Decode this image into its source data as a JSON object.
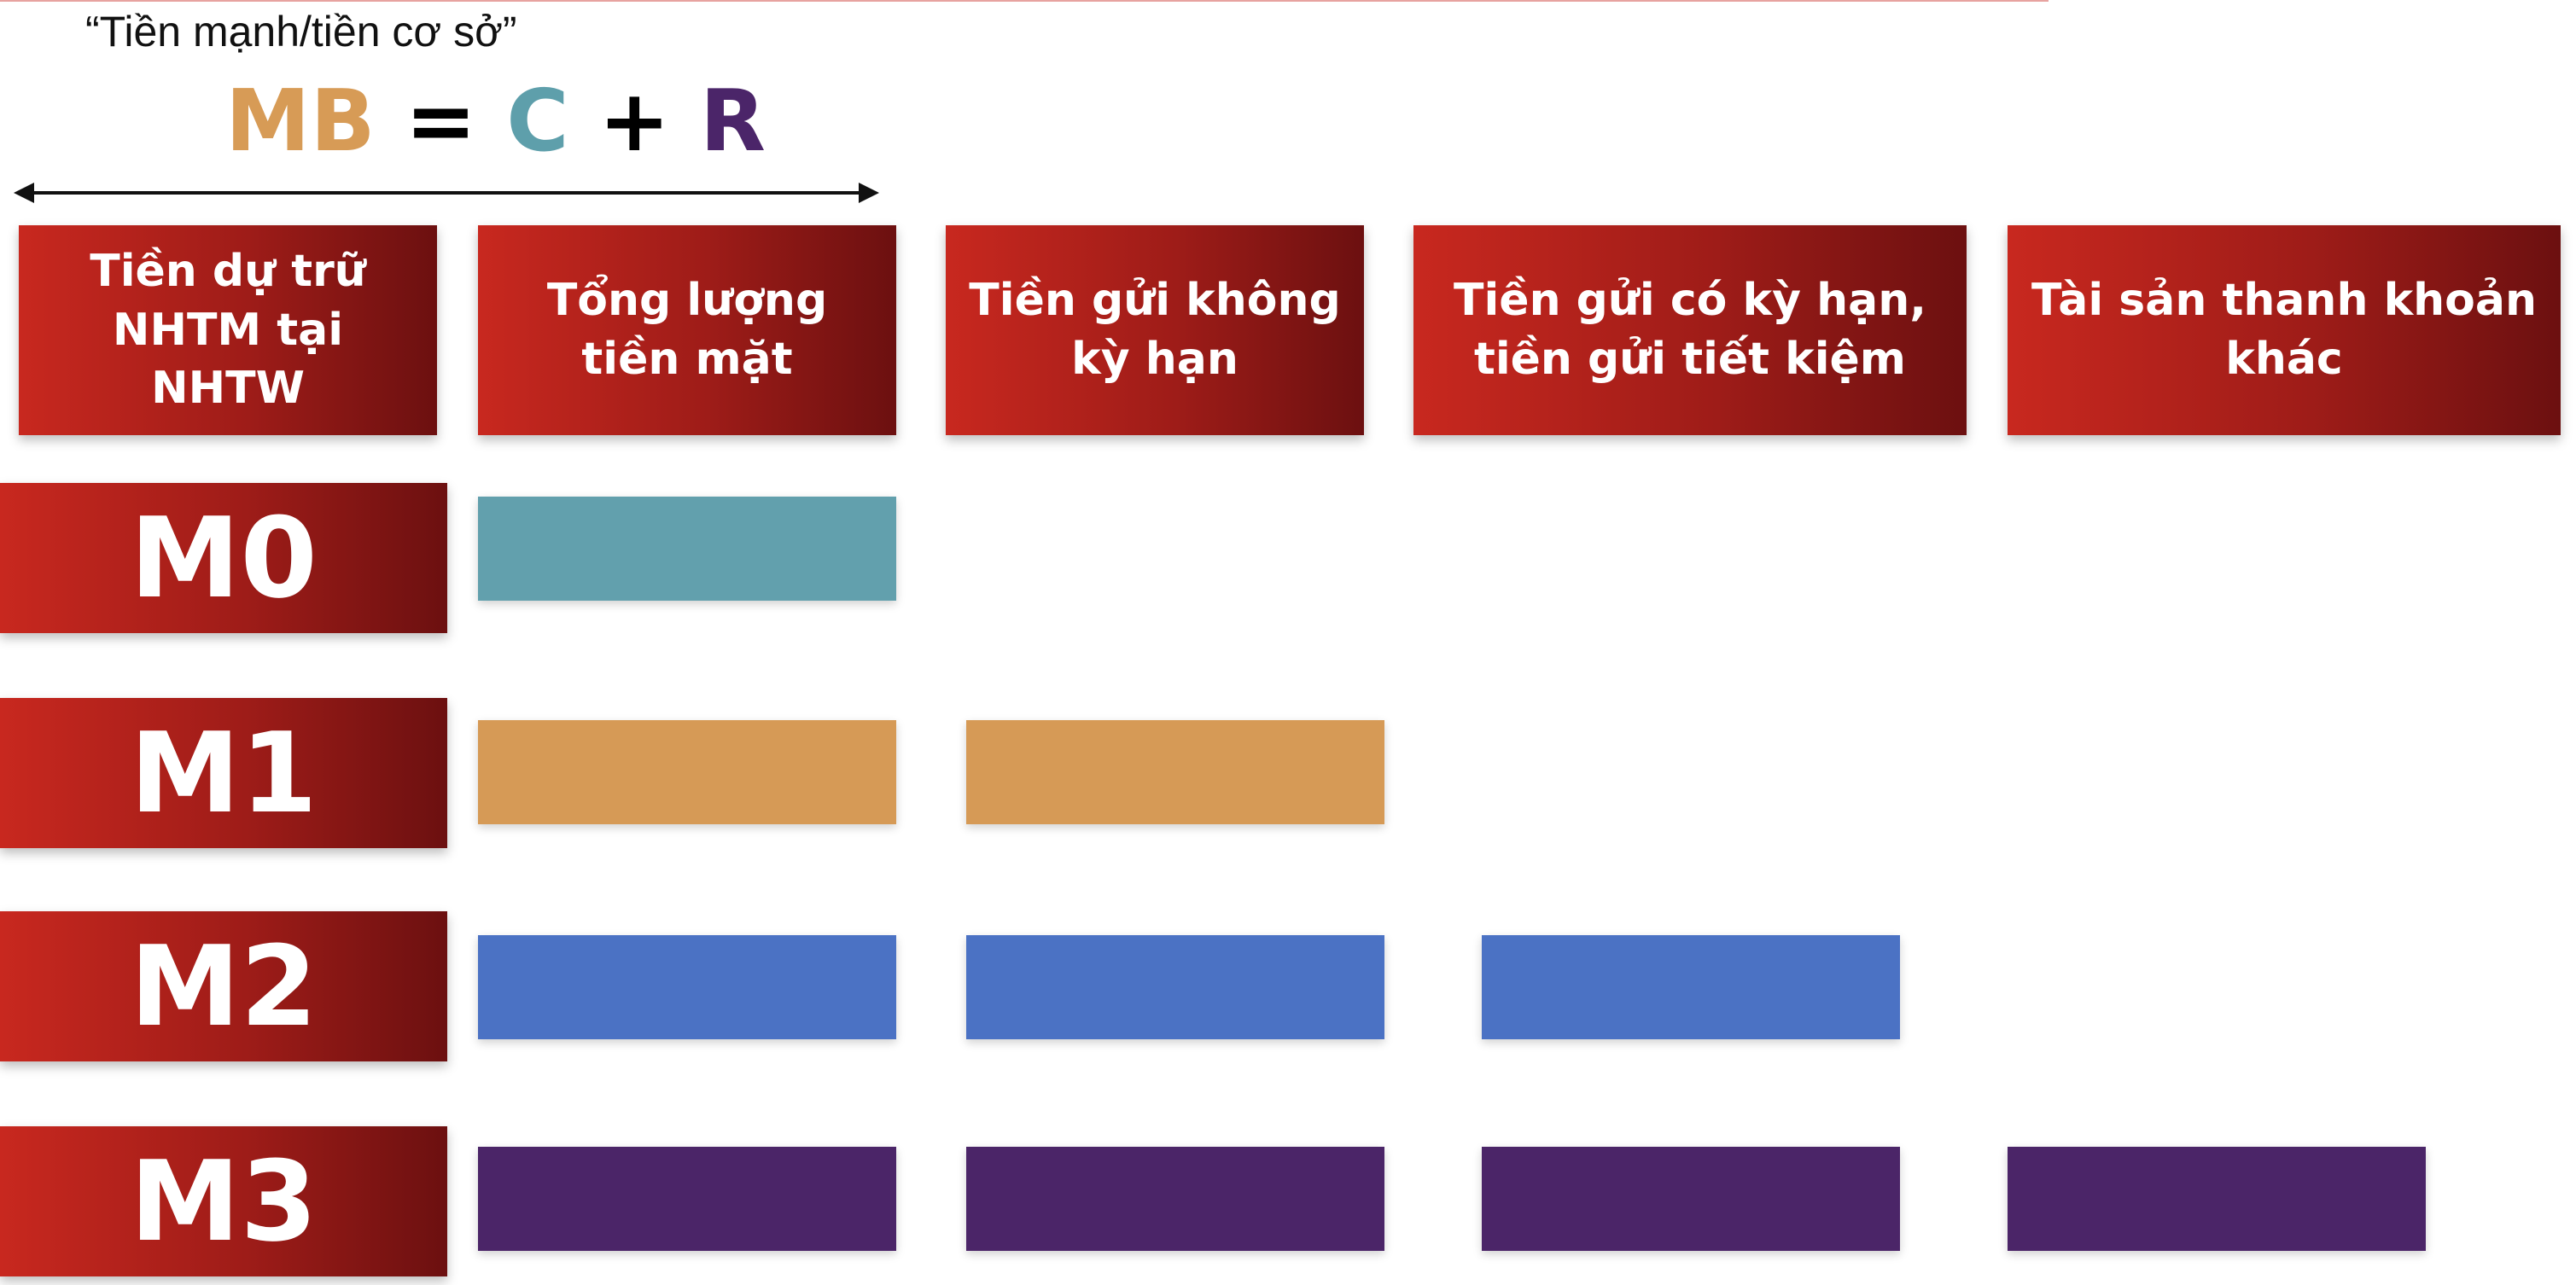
{
  "subtitle": "“Tiền mạnh/tiền cơ sở”",
  "formula": {
    "mb": "MB",
    "eq": "=",
    "c": "C",
    "plus": "+",
    "r": "R",
    "colors": {
      "mb": "#d79b56",
      "c": "#5e9fab",
      "r": "#4b2569",
      "op": "#000000"
    }
  },
  "columns": [
    {
      "id": "reserves",
      "label": "Tiền dự trữ\nNHTM tại\nNHTW"
    },
    {
      "id": "cash",
      "label": "Tổng lượng\ntiền mặt"
    },
    {
      "id": "demand",
      "label": "Tiền gửi không\nkỳ hạn"
    },
    {
      "id": "term",
      "label": "Tiền gửi có kỳ hạn,\ntiền gửi tiết kiệm"
    },
    {
      "id": "other",
      "label": "Tài sản thanh khoản\nkhác"
    }
  ],
  "rows": [
    {
      "label": "M0",
      "color": "#62a0ad",
      "includes": [
        "cash"
      ]
    },
    {
      "label": "M1",
      "color": "#d69a56",
      "includes": [
        "cash",
        "demand"
      ]
    },
    {
      "label": "M2",
      "color": "#4b72c4",
      "includes": [
        "cash",
        "demand",
        "term"
      ]
    },
    {
      "label": "M3",
      "color": "#4b2568",
      "includes": [
        "cash",
        "demand",
        "term",
        "other"
      ]
    }
  ],
  "colors": {
    "header_red": "#c8281f",
    "header_dark": "#6c1010"
  }
}
